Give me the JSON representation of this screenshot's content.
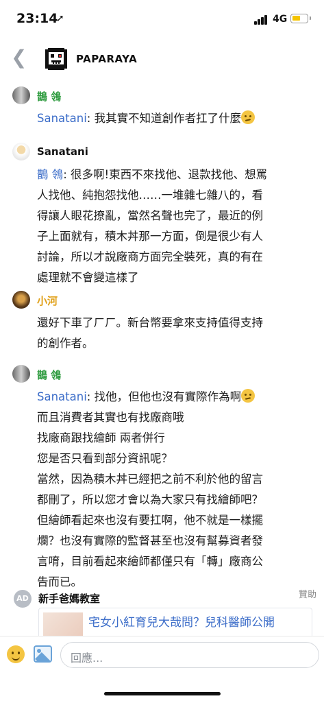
{
  "status": {
    "time": "23:14",
    "network": "4G"
  },
  "header": {
    "title": "PAPARAYA"
  },
  "messages": [
    {
      "user": "鵲 鴒",
      "user_color": "#2e9b3f",
      "mention": "Sanatani",
      "text": ": 我其實不知道創作者扛了什麼"
    },
    {
      "user": "Sanatani",
      "user_color": "#111111",
      "mention": "鵲 鴒",
      "lines": [
        ": 很多啊!東西不來找他、退款找他、想罵",
        "人找他、純抱怨找他……一堆雜七雜八的，看",
        "得讓人眼花撩亂，當然名聲也完了，最近的例",
        "子上面就有，積木丼那一方面，倒是很少有人",
        "討論，所以才說廠商方面完全裝死，真的有在",
        "處理就不會變這樣了"
      ]
    },
    {
      "user": "小河",
      "user_color": "#e0a018",
      "lines": [
        "還好下車了ㄏㄏ。新台幣要拿來支持值得支持",
        "的創作者。"
      ]
    },
    {
      "user": "鵲 鴒",
      "user_color": "#2e9b3f",
      "mention": "Sanatani",
      "lines": [
        ": 找他，但他也沒有實際作為啊",
        "而且消費者其實也有找廠商哦",
        "找廠商跟找繪師 兩者併行",
        "您是否只看到部分資訊呢？",
        "當然，因為積木丼已經把之前不利於他的留言",
        "都刪了，所以您才會以為大家只有找繪師吧？",
        "但繪師看起來也沒有要扛啊，他不就是一樣擺",
        "爛？也沒有實際的監督甚至也沒有幫募資者發",
        "言唷，目前看起來繪師都僅只有「轉」廠商公",
        "告而已。"
      ]
    }
  ],
  "ad": {
    "badge": "AD",
    "name": "新手爸媽教室",
    "sponsor_label": "贊助",
    "title": "宅女小紅育兒大哉問？兒科醫師公開"
  },
  "composer": {
    "placeholder": "回應..."
  },
  "colors": {
    "mention": "#3d6ec9",
    "link": "#3d6ec9"
  }
}
